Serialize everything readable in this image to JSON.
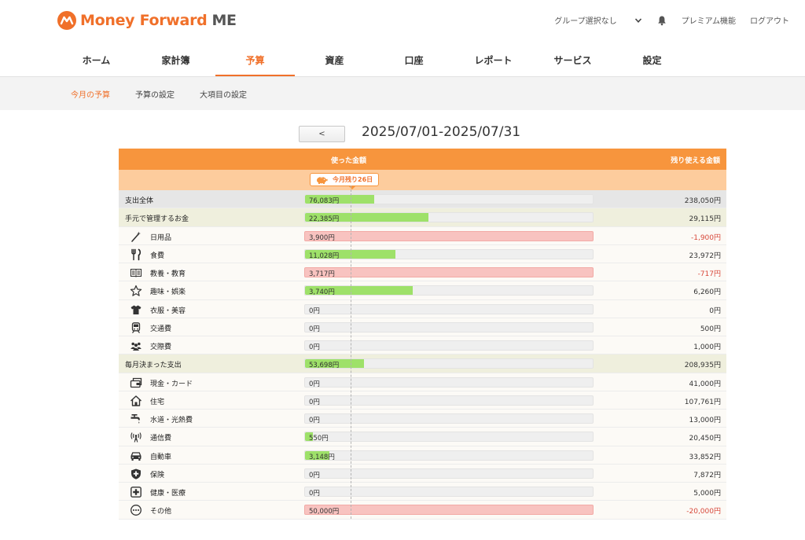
{
  "brand": {
    "name": "Money Forward",
    "suffix": "ME",
    "accent": "#f0702a"
  },
  "header": {
    "group_select": "グループ選択なし",
    "premium": "プレミアム機能",
    "logout": "ログアウト"
  },
  "main_nav": [
    {
      "label": "ホーム"
    },
    {
      "label": "家計簿"
    },
    {
      "label": "予算",
      "active": true
    },
    {
      "label": "資産"
    },
    {
      "label": "口座"
    },
    {
      "label": "レポート"
    },
    {
      "label": "サービス"
    },
    {
      "label": "設定"
    }
  ],
  "sub_nav": [
    {
      "label": "今月の予算",
      "active": true
    },
    {
      "label": "予算の設定"
    },
    {
      "label": "大項目の設定"
    }
  ],
  "period": {
    "prev_label": "<",
    "text": "2025/07/01-2025/07/31"
  },
  "table": {
    "col_used": "使った金額",
    "col_remaining": "残り使える金額",
    "marker": "今月残り26日",
    "rows": [
      {
        "kind": "total",
        "label": "支出全体",
        "used": "76,083円",
        "remaining": "238,050円",
        "progress": 0.24,
        "over": false
      },
      {
        "kind": "group",
        "label": "手元で管理するお金",
        "used": "22,385円",
        "remaining": "29,115円",
        "progress": 0.43,
        "over": false
      },
      {
        "kind": "item",
        "icon": "wand-icon",
        "label": "日用品",
        "used": "3,900円",
        "remaining": "-1,900円",
        "progress": 1,
        "over": true
      },
      {
        "kind": "item",
        "icon": "fork-knife-icon",
        "label": "食費",
        "used": "11,028円",
        "remaining": "23,972円",
        "progress": 0.315,
        "over": false
      },
      {
        "kind": "item",
        "icon": "book-icon",
        "label": "教養・教育",
        "used": "3,717円",
        "remaining": "-717円",
        "progress": 1,
        "over": true
      },
      {
        "kind": "item",
        "icon": "star-icon",
        "label": "趣味・娯楽",
        "used": "3,740円",
        "remaining": "6,260円",
        "progress": 0.374,
        "over": false
      },
      {
        "kind": "item",
        "icon": "shirt-icon",
        "label": "衣服・美容",
        "used": "0円",
        "remaining": "0円",
        "progress": 0,
        "over": false
      },
      {
        "kind": "item",
        "icon": "train-icon",
        "label": "交通費",
        "used": "0円",
        "remaining": "500円",
        "progress": 0,
        "over": false
      },
      {
        "kind": "item",
        "icon": "people-icon",
        "label": "交際費",
        "used": "0円",
        "remaining": "1,000円",
        "progress": 0,
        "over": false
      },
      {
        "kind": "group",
        "label": "毎月決まった支出",
        "used": "53,698円",
        "remaining": "208,935円",
        "progress": 0.204,
        "over": false
      },
      {
        "kind": "item",
        "icon": "card-icon",
        "label": "現金・カード",
        "used": "0円",
        "remaining": "41,000円",
        "progress": 0,
        "over": false
      },
      {
        "kind": "item",
        "icon": "house-icon",
        "label": "住宅",
        "used": "0円",
        "remaining": "107,761円",
        "progress": 0,
        "over": false
      },
      {
        "kind": "item",
        "icon": "faucet-icon",
        "label": "水道・光熱費",
        "used": "0円",
        "remaining": "13,000円",
        "progress": 0,
        "over": false
      },
      {
        "kind": "item",
        "icon": "antenna-icon",
        "label": "通信費",
        "used": "550円",
        "remaining": "20,450円",
        "progress": 0.026,
        "over": false
      },
      {
        "kind": "item",
        "icon": "car-icon",
        "label": "自動車",
        "used": "3,148円",
        "remaining": "33,852円",
        "progress": 0.085,
        "over": false
      },
      {
        "kind": "item",
        "icon": "shield-icon",
        "label": "保険",
        "used": "0円",
        "remaining": "7,872円",
        "progress": 0,
        "over": false
      },
      {
        "kind": "item",
        "icon": "medical-cross-icon",
        "label": "健康・医療",
        "used": "0円",
        "remaining": "5,000円",
        "progress": 0,
        "over": false
      },
      {
        "kind": "item",
        "icon": "ellipsis-circle-icon",
        "label": "その他",
        "used": "50,000円",
        "remaining": "-20,000円",
        "progress": 1,
        "over": true
      }
    ]
  }
}
